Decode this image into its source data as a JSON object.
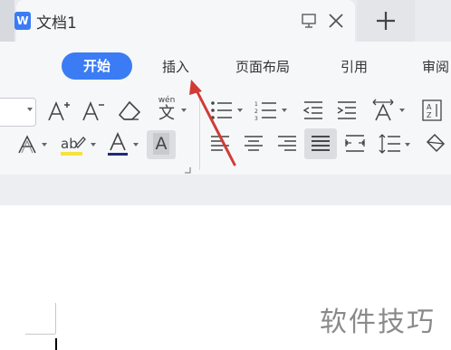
{
  "window": {
    "tab_title": "文档1",
    "app_icon_letter": "W"
  },
  "ribbon": {
    "tabs": [
      "开始",
      "插入",
      "页面布局",
      "引用",
      "审阅"
    ],
    "active_tab": "开始",
    "accent_color": "#3b7cf5"
  },
  "toolbar": {
    "pinyin_label": "wén",
    "pinyin_char": "文",
    "shading_letter": "A"
  },
  "icons": [
    "word-doc-icon",
    "monitor-icon",
    "close-icon",
    "plus-icon",
    "increase-font-icon",
    "decrease-font-icon",
    "eraser-icon",
    "pinyin-guide-icon",
    "bullet-list-icon",
    "numbered-list-icon",
    "decrease-indent-icon",
    "increase-indent-icon",
    "text-direction-icon",
    "sort-icon",
    "text-effect-icon",
    "highlight-icon",
    "font-color-icon",
    "char-shading-icon",
    "align-left-icon",
    "align-center-icon",
    "align-right-icon",
    "justify-icon",
    "distributed-icon",
    "line-spacing-icon",
    "paint-bucket-icon",
    "dialog-launcher-icon"
  ],
  "watermark": "软件技巧",
  "annotation_color": "#d13b36"
}
